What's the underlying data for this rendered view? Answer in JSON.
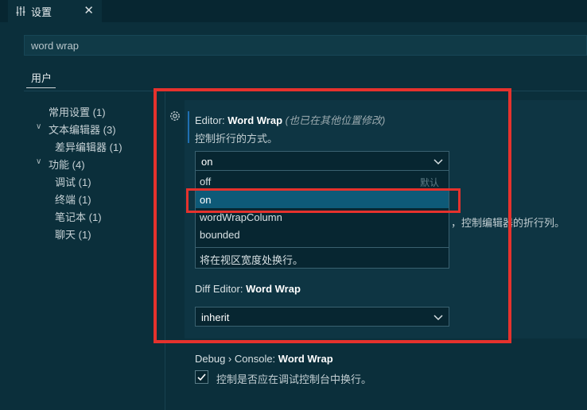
{
  "tab": {
    "icon": "settings-sliders-icon",
    "title": "设置",
    "close": "✕"
  },
  "search": {
    "value": "word wrap"
  },
  "scope": {
    "user_tab": "用户"
  },
  "toc": [
    {
      "label": "常用设置",
      "count": "(1)"
    },
    {
      "label": "文本编辑器",
      "count": "(3)"
    },
    {
      "label": "差异编辑器",
      "count": "(1)"
    },
    {
      "label": "功能",
      "count": "(4)"
    },
    {
      "label": "调试",
      "count": "(1)"
    },
    {
      "label": "终端",
      "count": "(1)"
    },
    {
      "label": "笔记本",
      "count": "(1)"
    },
    {
      "label": "聊天",
      "count": "(1)"
    }
  ],
  "settings": {
    "word_wrap": {
      "category": "Editor: ",
      "name": "Word Wrap",
      "modified_note": "(也已在其他位置修改)",
      "description": "控制折行的方式。",
      "value": "on",
      "options": [
        "off",
        "on",
        "wordWrapColumn",
        "bounded"
      ],
      "default_tag": "默认",
      "selected_description": "将在视区宽度处换行。"
    },
    "hidden_desc_fragment": "，控制编辑器的折行列。",
    "diff_word_wrap": {
      "category": "Diff Editor: ",
      "name": "Word Wrap",
      "value": "inherit"
    },
    "debug_word_wrap": {
      "category": "Debug › Console: ",
      "name": "Word Wrap",
      "description": "控制是否应在调试控制台中换行。",
      "checked": true
    }
  },
  "colors": {
    "highlight": "#e5322d",
    "selected_option": "#0e5a78",
    "background": "#0b2f3b"
  }
}
